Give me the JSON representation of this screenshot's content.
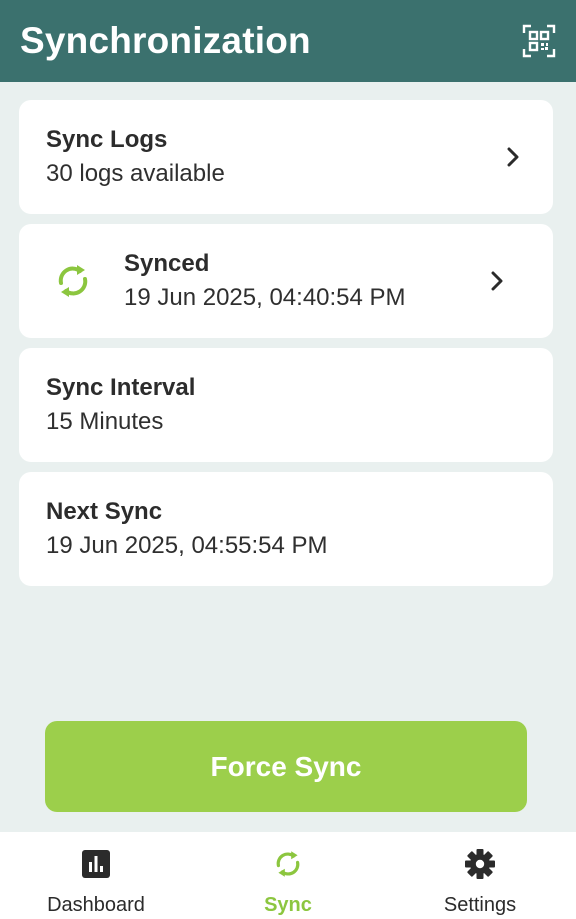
{
  "app_bar": {
    "title": "Synchronization",
    "action_icon": "qr-code-scan-icon",
    "background": "#3b716e"
  },
  "cards": {
    "sync_logs": {
      "title": "Sync Logs",
      "subtitle": "30 logs available"
    },
    "status": {
      "title": "Synced",
      "subtitle": "19 Jun 2025, 04:40:54 PM",
      "icon": "sync-icon"
    },
    "interval": {
      "title": "Sync Interval",
      "subtitle": "15 Minutes"
    },
    "next_sync": {
      "title": "Next Sync",
      "subtitle": "19 Jun 2025, 04:55:54 PM"
    }
  },
  "force_sync": {
    "label": "Force Sync",
    "color": "#9ccf4b"
  },
  "bottom_nav": {
    "items": [
      {
        "label": "Dashboard",
        "icon": "bar-chart-icon",
        "active": false
      },
      {
        "label": "Sync",
        "icon": "sync-icon",
        "active": true
      },
      {
        "label": "Settings",
        "icon": "gear-icon",
        "active": false
      }
    ],
    "active_color": "#8cc63f"
  }
}
